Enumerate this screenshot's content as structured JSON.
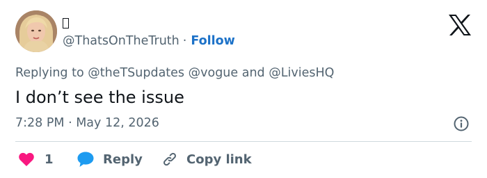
{
  "author": {
    "display_name_glyph": "▯",
    "handle": "@ThatsOnTheTruth",
    "separator": "·",
    "follow_label": "Follow"
  },
  "reply_context": {
    "prefix": "Replying to",
    "mention_1": "@theTSupdates",
    "mention_2": "@vogue",
    "conjunction": "and",
    "mention_3": "@LiviesHQ"
  },
  "tweet": {
    "text": "I don’t see the issue",
    "timestamp": "7:28 PM · May 12, 2026"
  },
  "actions": {
    "like_count": "1",
    "reply_label": "Reply",
    "copy_label": "Copy link"
  },
  "icons": {
    "brand": "x-logo-icon",
    "info": "info-icon",
    "like": "heart-icon",
    "reply": "speech-bubble-icon",
    "copy": "link-icon"
  },
  "colors": {
    "follow_link": "#1d72c8",
    "like_heart": "#f91880",
    "reply_bubble": "#1d9bf0",
    "secondary_text": "#536471",
    "primary_text": "#0f1419"
  }
}
